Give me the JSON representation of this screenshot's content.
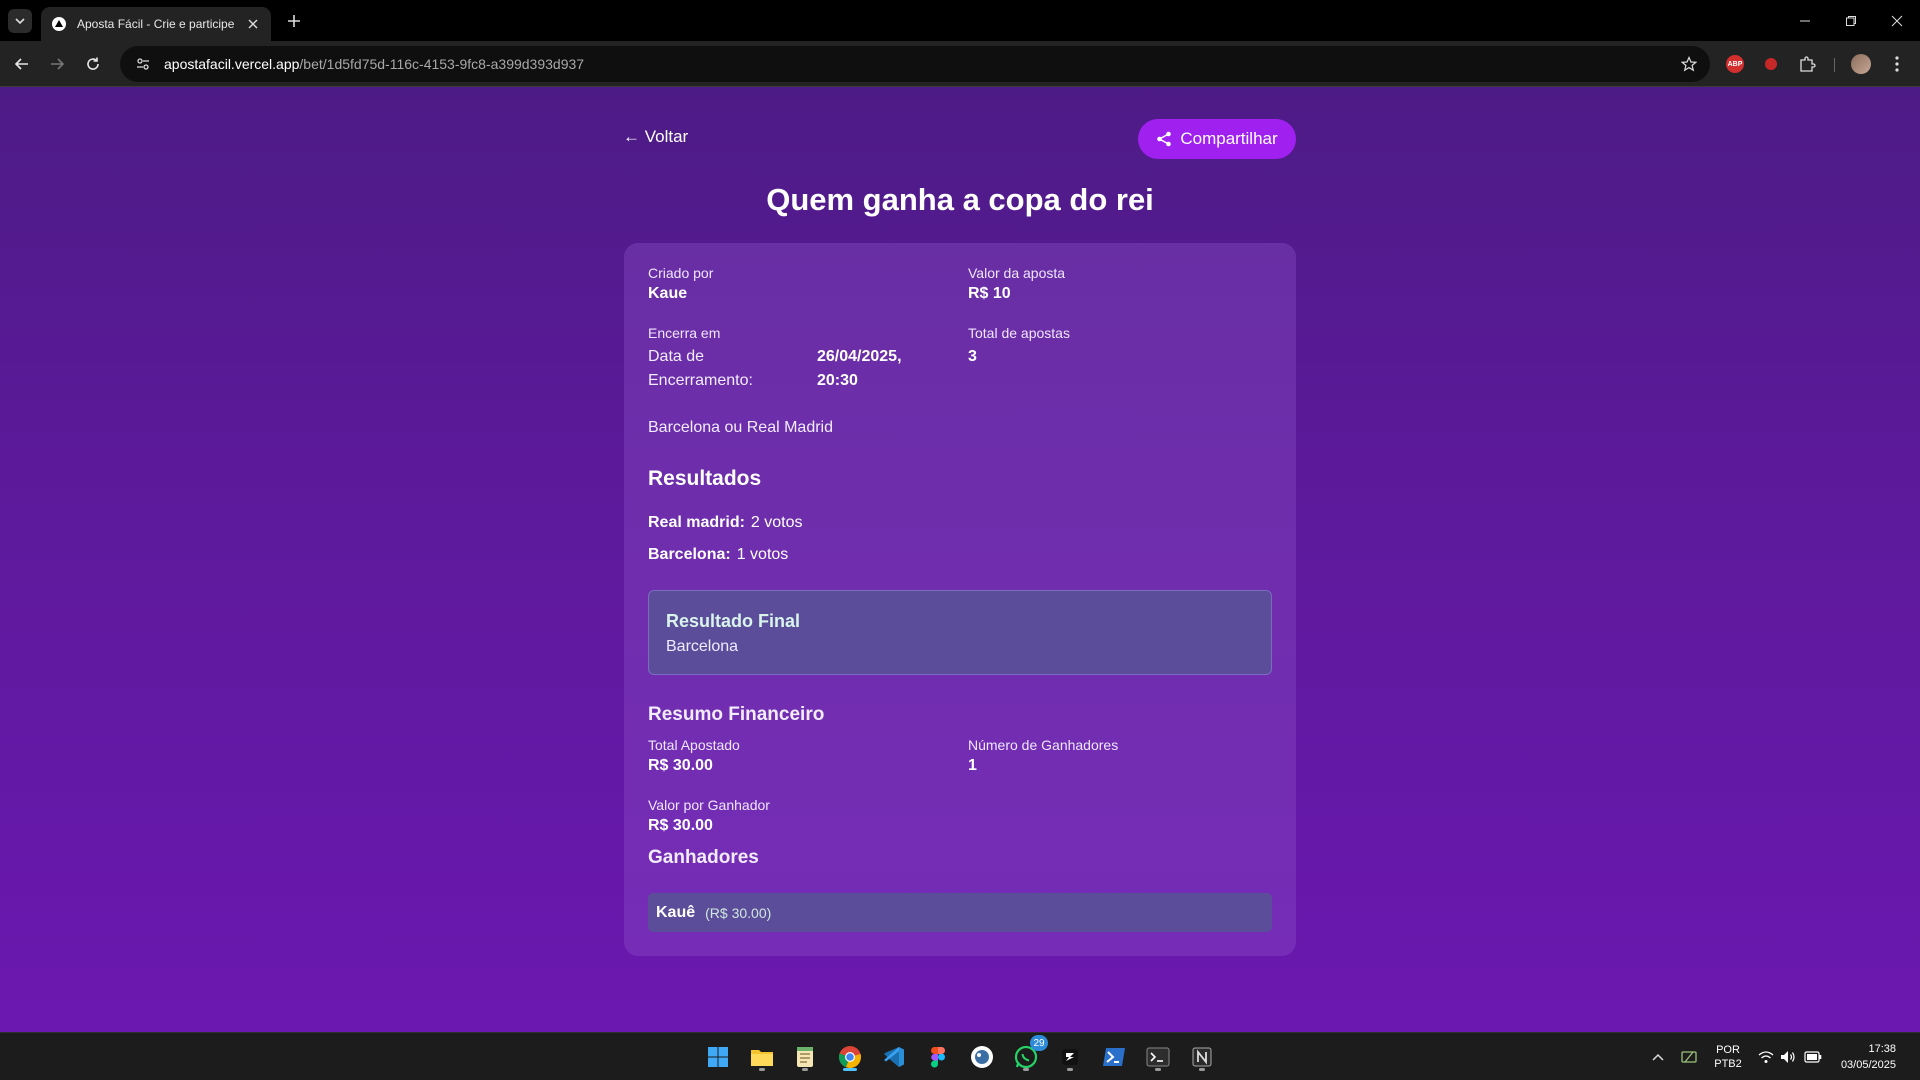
{
  "browser": {
    "tab_title": "Aposta Fácil - Crie e participe d",
    "url_host": "apostafacil.vercel.app",
    "url_path": "/bet/1d5fd75d-116c-4153-9fc8-a399d393d937"
  },
  "page": {
    "back_label": "← Voltar",
    "share_label": "Compartilhar",
    "title": "Quem ganha a copa do rei",
    "accent_color": "#a020f0"
  },
  "details": {
    "created_by_label": "Criado por",
    "created_by": "Kaue",
    "bet_value_label": "Valor da aposta",
    "bet_value": "R$ 10",
    "ends_label": "Encerra em",
    "end_date_label_line1": "Data de",
    "end_date_label_line2": "Encerramento:",
    "end_date_line1": "26/04/2025,",
    "end_date_line2": "20:30",
    "total_bets_label": "Total de apostas",
    "total_bets": "3",
    "description": "Barcelona ou Real Madrid"
  },
  "results": {
    "heading": "Resultados",
    "options": [
      {
        "name": "Real madrid:",
        "votes": "2 votos"
      },
      {
        "name": "Barcelona:",
        "votes": "1 votos"
      }
    ],
    "final_title": "Resultado Final",
    "final_value": "Barcelona"
  },
  "financial": {
    "heading": "Resumo Financeiro",
    "total_label": "Total Apostado",
    "total": "R$ 30.00",
    "winners_count_label": "Número de Ganhadores",
    "winners_count": "1",
    "per_winner_label": "Valor por Ganhador",
    "per_winner": "R$ 30.00"
  },
  "winners": {
    "heading": "Ganhadores",
    "list": [
      {
        "name": "Kauê",
        "amount": "(R$ 30.00)"
      }
    ]
  },
  "taskbar": {
    "whatsapp_badge": "29",
    "lang_line1": "POR",
    "lang_line2": "PTB2",
    "time": "17:38",
    "date": "03/05/2025"
  }
}
